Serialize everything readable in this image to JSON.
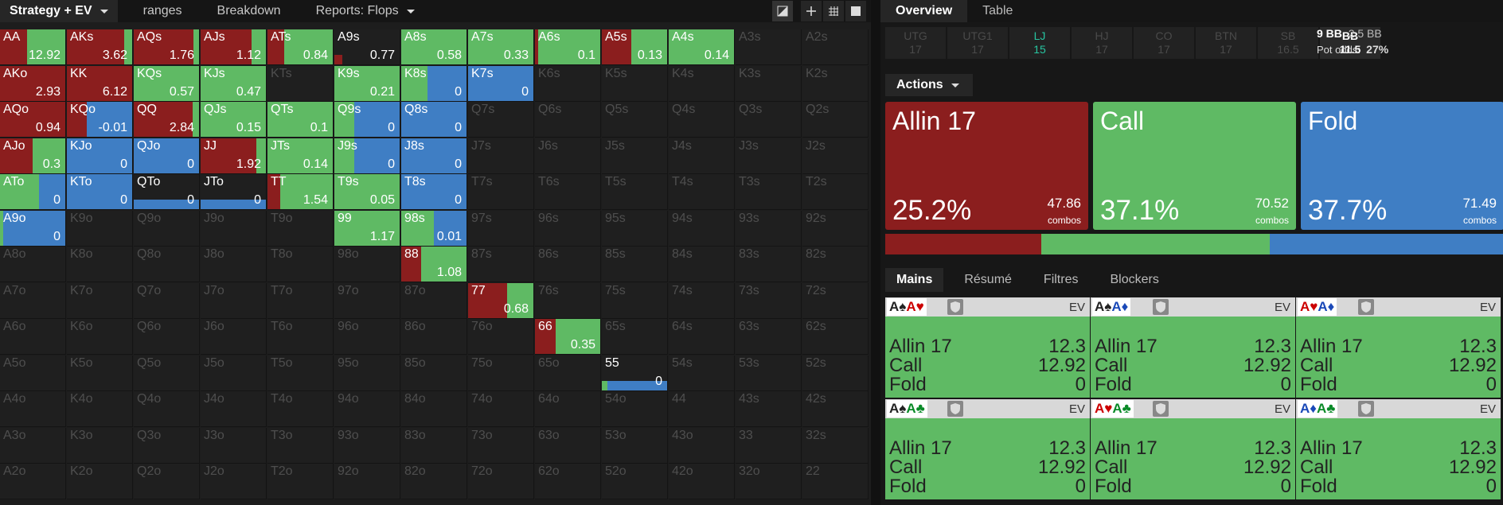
{
  "colors": {
    "allin": "#8b1e1e",
    "call": "#5fba64",
    "fold": "#3f7ec4"
  },
  "topbar": {
    "tab1": "Strategy + EV",
    "tab2": "ranges",
    "tab3": "Breakdown",
    "tab4": "Reports: Flops"
  },
  "toolbar_icons": [
    "contrast-icon",
    "move-icon",
    "grid-icon",
    "square-icon"
  ],
  "grid": [
    [
      {
        "l": "AA",
        "ev": "12.92",
        "a": 0.42,
        "c": 0.58,
        "f": 0,
        "on": 1
      },
      {
        "l": "AKs",
        "ev": "3.62",
        "a": 0.88,
        "c": 0.12,
        "f": 0,
        "on": 1
      },
      {
        "l": "AQs",
        "ev": "1.76",
        "a": 0.92,
        "c": 0.08,
        "f": 0,
        "on": 1
      },
      {
        "l": "AJs",
        "ev": "1.12",
        "a": 0.78,
        "c": 0.22,
        "f": 0,
        "on": 1
      },
      {
        "l": "ATs",
        "ev": "0.84",
        "a": 0.25,
        "c": 0.75,
        "f": 0,
        "on": 1
      },
      {
        "l": "A9s",
        "ev": "0.77",
        "a": 0.12,
        "c": 0.0,
        "f": 0,
        "on": 1
      },
      {
        "l": "A8s",
        "ev": "0.58",
        "a": 0,
        "c": 1.0,
        "f": 0,
        "on": 1
      },
      {
        "l": "A7s",
        "ev": "0.33",
        "a": 0,
        "c": 1.0,
        "f": 0,
        "on": 1
      },
      {
        "l": "A6s",
        "ev": "0.1",
        "a": 0.05,
        "c": 0.95,
        "f": 0,
        "on": 1
      },
      {
        "l": "A5s",
        "ev": "0.13",
        "a": 0.45,
        "c": 0.55,
        "f": 0,
        "on": 1
      },
      {
        "l": "A4s",
        "ev": "0.14",
        "a": 0,
        "c": 1.0,
        "f": 0,
        "on": 1
      },
      {
        "l": "A3s",
        "on": 0
      },
      {
        "l": "A2s",
        "on": 0
      }
    ],
    [
      {
        "l": "AKo",
        "ev": "2.93",
        "a": 1.0,
        "c": 0,
        "f": 0,
        "on": 1
      },
      {
        "l": "KK",
        "ev": "6.12",
        "a": 1.0,
        "c": 0,
        "f": 0,
        "on": 1
      },
      {
        "l": "KQs",
        "ev": "0.57",
        "a": 0,
        "c": 1.0,
        "f": 0,
        "on": 1
      },
      {
        "l": "KJs",
        "ev": "0.47",
        "a": 0,
        "c": 1.0,
        "f": 0,
        "on": 1
      },
      {
        "l": "KTs",
        "on": 0
      },
      {
        "l": "K9s",
        "ev": "0.21",
        "a": 0,
        "c": 1.0,
        "f": 0,
        "on": 1
      },
      {
        "l": "K8s",
        "ev": "0",
        "a": 0,
        "c": 0.4,
        "f": 0.6,
        "on": 1
      },
      {
        "l": "K7s",
        "ev": "0",
        "a": 0,
        "c": 0,
        "f": 1.0,
        "on": 1
      },
      {
        "l": "K6s",
        "on": 0
      },
      {
        "l": "K5s",
        "on": 0
      },
      {
        "l": "K4s",
        "on": 0
      },
      {
        "l": "K3s",
        "on": 0
      },
      {
        "l": "K2s",
        "on": 0
      }
    ],
    [
      {
        "l": "AQo",
        "ev": "0.94",
        "a": 1.0,
        "c": 0,
        "f": 0,
        "on": 1
      },
      {
        "l": "KQo",
        "ev": "-0.01",
        "a": 0.3,
        "c": 0,
        "f": 0.7,
        "on": 1
      },
      {
        "l": "QQ",
        "ev": "2.84",
        "a": 0.9,
        "c": 0.1,
        "f": 0,
        "on": 1
      },
      {
        "l": "QJs",
        "ev": "0.15",
        "a": 0,
        "c": 1.0,
        "f": 0,
        "on": 1
      },
      {
        "l": "QTs",
        "ev": "0.1",
        "a": 0,
        "c": 1.0,
        "f": 0,
        "on": 1
      },
      {
        "l": "Q9s",
        "ev": "0",
        "a": 0,
        "c": 0.3,
        "f": 0.7,
        "on": 1
      },
      {
        "l": "Q8s",
        "ev": "0",
        "a": 0,
        "c": 0,
        "f": 1.0,
        "on": 1
      },
      {
        "l": "Q7s",
        "on": 0
      },
      {
        "l": "Q6s",
        "on": 0
      },
      {
        "l": "Q5s",
        "on": 0
      },
      {
        "l": "Q4s",
        "on": 0
      },
      {
        "l": "Q3s",
        "on": 0
      },
      {
        "l": "Q2s",
        "on": 0
      }
    ],
    [
      {
        "l": "AJo",
        "ev": "0.3",
        "a": 0.5,
        "c": 0.5,
        "f": 0,
        "on": 1
      },
      {
        "l": "KJo",
        "ev": "0",
        "a": 0,
        "c": 0,
        "f": 1.0,
        "on": 1
      },
      {
        "l": "QJo",
        "ev": "0",
        "a": 0,
        "c": 0,
        "f": 1.0,
        "on": 1
      },
      {
        "l": "JJ",
        "ev": "1.92",
        "a": 0.85,
        "c": 0.15,
        "f": 0,
        "on": 1
      },
      {
        "l": "JTs",
        "ev": "0.14",
        "a": 0,
        "c": 1.0,
        "f": 0,
        "on": 1
      },
      {
        "l": "J9s",
        "ev": "0",
        "a": 0,
        "c": 0.3,
        "f": 0.7,
        "on": 1
      },
      {
        "l": "J8s",
        "ev": "0",
        "a": 0,
        "c": 0,
        "f": 1.0,
        "on": 1
      },
      {
        "l": "J7s",
        "on": 0
      },
      {
        "l": "J6s",
        "on": 0
      },
      {
        "l": "J5s",
        "on": 0
      },
      {
        "l": "J4s",
        "on": 0
      },
      {
        "l": "J3s",
        "on": 0
      },
      {
        "l": "J2s",
        "on": 0
      }
    ],
    [
      {
        "l": "ATo",
        "ev": "0",
        "a": 0,
        "c": 0.6,
        "f": 0.4,
        "on": 1
      },
      {
        "l": "KTo",
        "ev": "0",
        "a": 0,
        "c": 0,
        "f": 1.0,
        "on": 1
      },
      {
        "l": "QTo",
        "ev": "0",
        "a": 0,
        "c": 0,
        "f": 1.0,
        "on": 1
      },
      {
        "l": "JTo",
        "ev": "0",
        "a": 0,
        "c": 0,
        "f": 1.0,
        "on": 1
      },
      {
        "l": "TT",
        "ev": "1.54",
        "a": 0.2,
        "c": 0.8,
        "f": 0,
        "on": 1
      },
      {
        "l": "T9s",
        "ev": "0.05",
        "a": 0,
        "c": 1.0,
        "f": 0,
        "on": 1
      },
      {
        "l": "T8s",
        "ev": "0",
        "a": 0,
        "c": 0,
        "f": 1.0,
        "on": 1
      },
      {
        "l": "T7s",
        "on": 0
      },
      {
        "l": "T6s",
        "on": 0
      },
      {
        "l": "T5s",
        "on": 0
      },
      {
        "l": "T4s",
        "on": 0
      },
      {
        "l": "T3s",
        "on": 0
      },
      {
        "l": "T2s",
        "on": 0
      }
    ],
    [
      {
        "l": "A9o",
        "ev": "0",
        "a": 0,
        "c": 0.05,
        "f": 0.95,
        "on": 1
      },
      {
        "l": "K9o",
        "on": 0
      },
      {
        "l": "Q9o",
        "on": 0
      },
      {
        "l": "J9o",
        "on": 0
      },
      {
        "l": "T9o",
        "on": 0
      },
      {
        "l": "99",
        "ev": "1.17",
        "a": 0,
        "c": 1.0,
        "f": 0,
        "on": 1
      },
      {
        "l": "98s",
        "ev": "0.01",
        "a": 0,
        "c": 0.5,
        "f": 0.5,
        "on": 1
      },
      {
        "l": "97s",
        "on": 0
      },
      {
        "l": "96s",
        "on": 0
      },
      {
        "l": "95s",
        "on": 0
      },
      {
        "l": "94s",
        "on": 0
      },
      {
        "l": "93s",
        "on": 0
      },
      {
        "l": "92s",
        "on": 0
      }
    ],
    [
      {
        "l": "A8o",
        "on": 0
      },
      {
        "l": "K8o",
        "on": 0
      },
      {
        "l": "Q8o",
        "on": 0
      },
      {
        "l": "J8o",
        "on": 0
      },
      {
        "l": "T8o",
        "on": 0
      },
      {
        "l": "98o",
        "on": 0
      },
      {
        "l": "88",
        "ev": "1.08",
        "a": 0.3,
        "c": 0.7,
        "f": 0,
        "on": 1
      },
      {
        "l": "87s",
        "on": 0
      },
      {
        "l": "86s",
        "on": 0
      },
      {
        "l": "85s",
        "on": 0
      },
      {
        "l": "84s",
        "on": 0
      },
      {
        "l": "83s",
        "on": 0
      },
      {
        "l": "82s",
        "on": 0
      }
    ],
    [
      {
        "l": "A7o",
        "on": 0
      },
      {
        "l": "K7o",
        "on": 0
      },
      {
        "l": "Q7o",
        "on": 0
      },
      {
        "l": "J7o",
        "on": 0
      },
      {
        "l": "T7o",
        "on": 0
      },
      {
        "l": "97o",
        "on": 0
      },
      {
        "l": "87o",
        "on": 0
      },
      {
        "l": "77",
        "ev": "0.68",
        "a": 0.6,
        "c": 0.4,
        "f": 0,
        "on": 1
      },
      {
        "l": "76s",
        "on": 0
      },
      {
        "l": "75s",
        "on": 0
      },
      {
        "l": "74s",
        "on": 0
      },
      {
        "l": "73s",
        "on": 0
      },
      {
        "l": "72s",
        "on": 0
      }
    ],
    [
      {
        "l": "A6o",
        "on": 0
      },
      {
        "l": "K6o",
        "on": 0
      },
      {
        "l": "Q6o",
        "on": 0
      },
      {
        "l": "J6o",
        "on": 0
      },
      {
        "l": "T6o",
        "on": 0
      },
      {
        "l": "96o",
        "on": 0
      },
      {
        "l": "86o",
        "on": 0
      },
      {
        "l": "76o",
        "on": 0
      },
      {
        "l": "66",
        "ev": "0.35",
        "a": 0.32,
        "c": 0.68,
        "f": 0,
        "on": 1
      },
      {
        "l": "65s",
        "on": 0
      },
      {
        "l": "64s",
        "on": 0
      },
      {
        "l": "63s",
        "on": 0
      },
      {
        "l": "62s",
        "on": 0
      }
    ],
    [
      {
        "l": "A5o",
        "on": 0
      },
      {
        "l": "K5o",
        "on": 0
      },
      {
        "l": "Q5o",
        "on": 0
      },
      {
        "l": "J5o",
        "on": 0
      },
      {
        "l": "T5o",
        "on": 0
      },
      {
        "l": "95o",
        "on": 0
      },
      {
        "l": "85o",
        "on": 0
      },
      {
        "l": "75o",
        "on": 0
      },
      {
        "l": "65o",
        "on": 0
      },
      {
        "l": "55",
        "ev": "0",
        "a": 0,
        "c": 0.08,
        "f": 0.92,
        "on": 1
      },
      {
        "l": "54s",
        "on": 0
      },
      {
        "l": "53s",
        "on": 0
      },
      {
        "l": "52s",
        "on": 0
      }
    ],
    [
      {
        "l": "A4o",
        "on": 0
      },
      {
        "l": "K4o",
        "on": 0
      },
      {
        "l": "Q4o",
        "on": 0
      },
      {
        "l": "J4o",
        "on": 0
      },
      {
        "l": "T4o",
        "on": 0
      },
      {
        "l": "94o",
        "on": 0
      },
      {
        "l": "84o",
        "on": 0
      },
      {
        "l": "74o",
        "on": 0
      },
      {
        "l": "64o",
        "on": 0
      },
      {
        "l": "54o",
        "on": 0
      },
      {
        "l": "44",
        "on": 0
      },
      {
        "l": "43s",
        "on": 0
      },
      {
        "l": "42s",
        "on": 0
      }
    ],
    [
      {
        "l": "A3o",
        "on": 0
      },
      {
        "l": "K3o",
        "on": 0
      },
      {
        "l": "Q3o",
        "on": 0
      },
      {
        "l": "J3o",
        "on": 0
      },
      {
        "l": "T3o",
        "on": 0
      },
      {
        "l": "93o",
        "on": 0
      },
      {
        "l": "83o",
        "on": 0
      },
      {
        "l": "73o",
        "on": 0
      },
      {
        "l": "63o",
        "on": 0
      },
      {
        "l": "53o",
        "on": 0
      },
      {
        "l": "43o",
        "on": 0
      },
      {
        "l": "33",
        "on": 0
      },
      {
        "l": "32s",
        "on": 0
      }
    ],
    [
      {
        "l": "A2o",
        "on": 0
      },
      {
        "l": "K2o",
        "on": 0
      },
      {
        "l": "Q2o",
        "on": 0
      },
      {
        "l": "J2o",
        "on": 0
      },
      {
        "l": "T2o",
        "on": 0
      },
      {
        "l": "92o",
        "on": 0
      },
      {
        "l": "82o",
        "on": 0
      },
      {
        "l": "72o",
        "on": 0
      },
      {
        "l": "62o",
        "on": 0
      },
      {
        "l": "52o",
        "on": 0
      },
      {
        "l": "42o",
        "on": 0
      },
      {
        "l": "32o",
        "on": 0
      },
      {
        "l": "22",
        "on": 0
      }
    ]
  ],
  "right": {
    "tab1": "Overview",
    "tab2": "Table",
    "positions": [
      {
        "name": "UTG",
        "stack": "17"
      },
      {
        "name": "UTG1",
        "stack": "17"
      },
      {
        "name": "LJ",
        "stack": "15"
      },
      {
        "name": "HJ",
        "stack": "17"
      },
      {
        "name": "CO",
        "stack": "17"
      },
      {
        "name": "BTN",
        "stack": "17"
      },
      {
        "name": "SB",
        "stack": "16.5"
      },
      {
        "name": "BB",
        "stack": "11.5"
      }
    ],
    "bb_line": "9 BB",
    "bb_line2": "2.5 BB",
    "pot_odds_label": "Pot odds:",
    "pot_odds": "27%",
    "actions_label": "Actions",
    "actions": [
      {
        "name": "Allin 17",
        "pct": "25.2%",
        "combos": "47.86",
        "combos_label": "combos",
        "share": 0.252
      },
      {
        "name": "Call",
        "pct": "37.1%",
        "combos": "70.52",
        "combos_label": "combos",
        "share": 0.371
      },
      {
        "name": "Fold",
        "pct": "37.7%",
        "combos": "71.49",
        "combos_label": "combos",
        "share": 0.377
      }
    ],
    "bottom_tabs": [
      "Mains",
      "Résumé",
      "Filtres",
      "Blockers"
    ],
    "ev_label": "EV",
    "hands": [
      {
        "cards": [
          [
            "A♠",
            "blk"
          ],
          [
            "A♥",
            "red"
          ]
        ],
        "rows": [
          [
            "Allin 17",
            "12.3"
          ],
          [
            "Call",
            "12.92"
          ],
          [
            "Fold",
            "0"
          ]
        ]
      },
      {
        "cards": [
          [
            "A♠",
            "blk"
          ],
          [
            "A♦",
            "blu"
          ]
        ],
        "rows": [
          [
            "Allin 17",
            "12.3"
          ],
          [
            "Call",
            "12.92"
          ],
          [
            "Fold",
            "0"
          ]
        ]
      },
      {
        "cards": [
          [
            "A♥",
            "red"
          ],
          [
            "A♦",
            "blu"
          ]
        ],
        "rows": [
          [
            "Allin 17",
            "12.3"
          ],
          [
            "Call",
            "12.92"
          ],
          [
            "Fold",
            "0"
          ]
        ]
      },
      {
        "cards": [
          [
            "A♠",
            "blk"
          ],
          [
            "A♣",
            "grn"
          ]
        ],
        "rows": [
          [
            "Allin 17",
            "12.3"
          ],
          [
            "Call",
            "12.92"
          ],
          [
            "Fold",
            "0"
          ]
        ]
      },
      {
        "cards": [
          [
            "A♥",
            "red"
          ],
          [
            "A♣",
            "grn"
          ]
        ],
        "rows": [
          [
            "Allin 17",
            "12.3"
          ],
          [
            "Call",
            "12.92"
          ],
          [
            "Fold",
            "0"
          ]
        ]
      },
      {
        "cards": [
          [
            "A♦",
            "blu"
          ],
          [
            "A♣",
            "grn"
          ]
        ],
        "rows": [
          [
            "Allin 17",
            "12.3"
          ],
          [
            "Call",
            "12.92"
          ],
          [
            "Fold",
            "0"
          ]
        ]
      }
    ]
  }
}
